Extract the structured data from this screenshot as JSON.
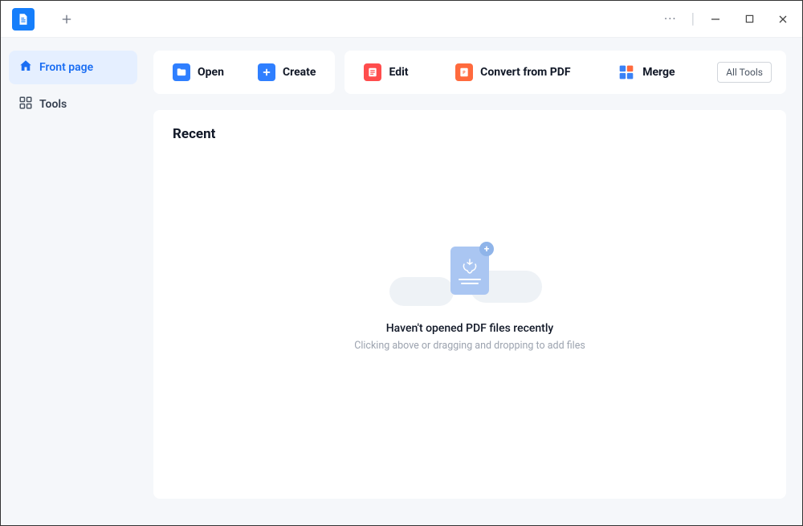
{
  "sidebar": {
    "items": [
      {
        "label": "Front page",
        "icon": "home-icon",
        "active": true
      },
      {
        "label": "Tools",
        "icon": "grid-icon",
        "active": false
      }
    ]
  },
  "toolbar": {
    "open_label": "Open",
    "create_label": "Create",
    "edit_label": "Edit",
    "convert_label": "Convert from PDF",
    "merge_label": "Merge",
    "all_tools_label": "All Tools"
  },
  "recent": {
    "title": "Recent",
    "empty_primary": "Haven't opened PDF files recently",
    "empty_secondary": "Clicking above or dragging and dropping to add files"
  },
  "colors": {
    "accent": "#1b6ef3",
    "folder": "#2f7fff",
    "create": "#2f7fff",
    "edit": "#ff4d4d",
    "convert": "#ff6a3d",
    "merge": "#3b82f6"
  }
}
